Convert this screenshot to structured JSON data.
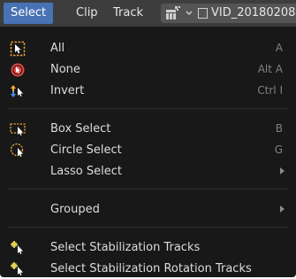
{
  "header": {
    "menus": [
      {
        "label": "Select"
      },
      {
        "label": "Clip"
      },
      {
        "label": "Track"
      }
    ],
    "view_icon": "clip-view-icon",
    "clip_name": "VID_20180208"
  },
  "select_menu": {
    "items": [
      {
        "label": "All",
        "shortcut": "A",
        "icon": "select-all-icon"
      },
      {
        "label": "None",
        "shortcut": "Alt A",
        "icon": "select-none-icon"
      },
      {
        "label": "Invert",
        "shortcut": "Ctrl I",
        "icon": "select-invert-icon"
      },
      {
        "label": "Box Select",
        "shortcut": "B",
        "icon": "box-select-icon"
      },
      {
        "label": "Circle Select",
        "shortcut": "G",
        "icon": "circle-select-icon"
      },
      {
        "label": "Lasso Select",
        "shortcut": "",
        "icon": ""
      },
      {
        "label": "Grouped",
        "shortcut": "",
        "icon": ""
      },
      {
        "label": "Select Stabilization Tracks",
        "shortcut": "",
        "icon": "stabilization-tracks-icon"
      },
      {
        "label": "Select Stabilization Rotation Tracks",
        "shortcut": "",
        "icon": "stabilization-rotation-tracks-icon"
      }
    ]
  },
  "colors": {
    "accent": "#4772b3",
    "menu_bg": "#181818",
    "header_bg": "#3d3d3d",
    "icon_orange": "#e8a23a",
    "icon_red": "#e84545",
    "icon_yellow": "#f2e15a"
  }
}
